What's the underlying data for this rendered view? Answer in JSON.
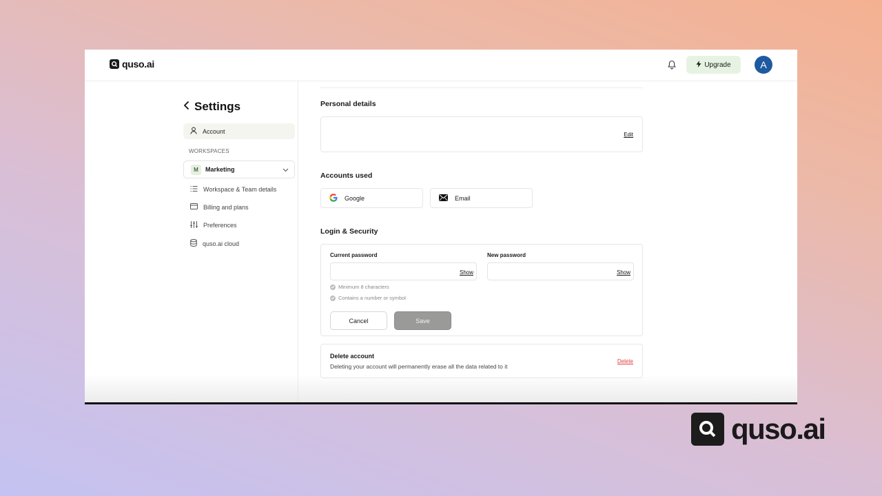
{
  "app": {
    "brand": "quso.ai"
  },
  "topbar": {
    "upgrade_label": "Upgrade",
    "avatar_initial": "A"
  },
  "sidebar": {
    "title": "Settings",
    "account_label": "Account",
    "workspaces_heading": "WORKSPACES",
    "workspace": {
      "initial": "M",
      "name": "Marketing"
    },
    "items": [
      {
        "label": "Workspace & Team details",
        "icon": "list-icon"
      },
      {
        "label": "Billing and plans",
        "icon": "card-icon"
      },
      {
        "label": "Preferences",
        "icon": "sliders-icon"
      },
      {
        "label": "quso.ai cloud",
        "icon": "database-icon"
      }
    ]
  },
  "personal_details": {
    "title": "Personal details",
    "edit_label": "Edit"
  },
  "accounts_used": {
    "title": "Accounts used",
    "google_label": "Google",
    "email_label": "Email"
  },
  "security": {
    "title": "Login & Security",
    "current_password_label": "Current password",
    "new_password_label": "New password",
    "show_label": "Show",
    "rule_1": "Minimum 8 characters",
    "rule_2": "Contains a number or symbol",
    "cancel_label": "Cancel",
    "save_label": "Save"
  },
  "delete_account": {
    "title": "Delete account",
    "description": "Deleting your account will permanently erase all the data related to it",
    "delete_label": "Delete"
  },
  "colors": {
    "accent_green_bg": "#e7f3e2",
    "avatar_bg": "#1e5aa0",
    "danger": "#e33d3d",
    "save_disabled": "#9a9a98"
  }
}
